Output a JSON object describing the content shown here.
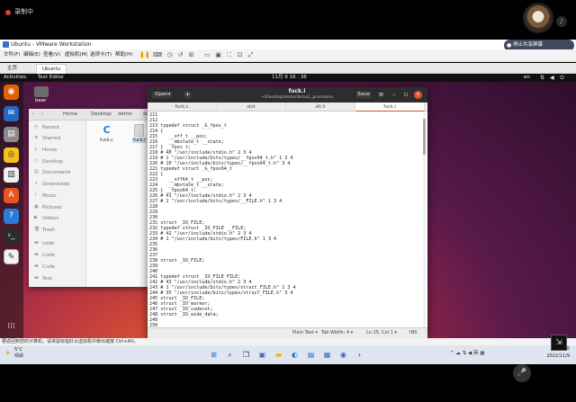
{
  "recording": {
    "label": "录制中"
  },
  "share_pill": {
    "label": "停止共享屏幕"
  },
  "vmware": {
    "title": "Ubuntu - VMware Workstation",
    "menu": [
      "文件(F)",
      "编辑(E)",
      "查看(V)",
      "虚拟机(M)",
      "选项卡(T)",
      "帮助(H)"
    ],
    "tabs": {
      "home": "主页",
      "ubuntu": "Ubuntu"
    },
    "hint": "要返回到您的计算机，请将鼠标指针从虚拟机中移出或按 Ctrl+Alt。"
  },
  "ubuntu": {
    "activities": "Activities",
    "app_name": "Text Editor",
    "clock": "11月 9 16 : 36",
    "kbd": "en",
    "desktop_home_label": "bear"
  },
  "nautilus": {
    "breadcrumbs": [
      "Home",
      "Desktop",
      "demo",
      "demo1"
    ],
    "sidebar": [
      "Recent",
      "Starred",
      "Home",
      "Desktop",
      "Documents",
      "Downloads",
      "Music",
      "Pictures",
      "Videos",
      "Trash",
      "code",
      "Code",
      "Code",
      "Test"
    ],
    "files": [
      {
        "name": "fuck.c"
      },
      {
        "name": "fuck.i"
      }
    ]
  },
  "gedit": {
    "open_label": "Open",
    "title": "fuck.i",
    "path": "~/Desktop/demo/demo1_procedure",
    "save_label": "Save",
    "tabs": [
      "fuck.c",
      "stst",
      "stt.h",
      "fuck.i"
    ],
    "status": {
      "syntax": "Plain Text ▾",
      "tab_width": "Tab Width: 4 ▾",
      "position": "Ln 25, Col 1 ▾",
      "mode": "INS"
    },
    "lines": [
      "211",
      "212",
      "213 typedef struct _G_fpos_t",
      "214 {",
      "215    __off_t __pos;",
      "216    __mbstate_t __state;",
      "217 } __fpos_t;",
      "218 # 40 \"/usr/include/stdio.h\" 2 3 4",
      "219 # 1 \"/usr/include/bits/types/__fpos64_t.h\" 1 3 4",
      "220 # 10 \"/usr/include/bits/types/__fpos64_t.h\" 3 4",
      "221 typedef struct _G_fpos64_t",
      "222 {",
      "223    __off64_t __pos;",
      "224    __mbstate_t __state;",
      "225 } __fpos64_t;",
      "226 # 41 \"/usr/include/stdio.h\" 2 3 4",
      "227 # 1 \"/usr/include/bits/types/__FILE.h\" 1 3 4",
      "228",
      "229",
      "230",
      "231 struct _IO_FILE;",
      "232 typedef struct _IO_FILE __FILE;",
      "233 # 42 \"/usr/include/stdio.h\" 2 3 4",
      "234 # 1 \"/usr/include/bits/types/FILE.h\" 1 3 4",
      "235",
      "236",
      "237",
      "238 struct _IO_FILE;",
      "239",
      "240",
      "241 typedef struct _IO_FILE FILE;",
      "242 # 43 \"/usr/include/stdio.h\" 2 3 4",
      "243 # 1 \"/usr/include/bits/types/struct_FILE.h\" 1 3 4",
      "244 # 35 \"/usr/include/bits/types/struct_FILE.h\" 3 4",
      "245 struct _IO_FILE;",
      "246 struct _IO_marker;",
      "247 struct _IO_codecvt;",
      "248 struct _IO_wide_data;",
      "249",
      "250"
    ]
  },
  "taskbar": {
    "weather_temp": "5°C",
    "weather_desc": "晴朗",
    "time": "16:36",
    "date": "2022/11/9"
  }
}
